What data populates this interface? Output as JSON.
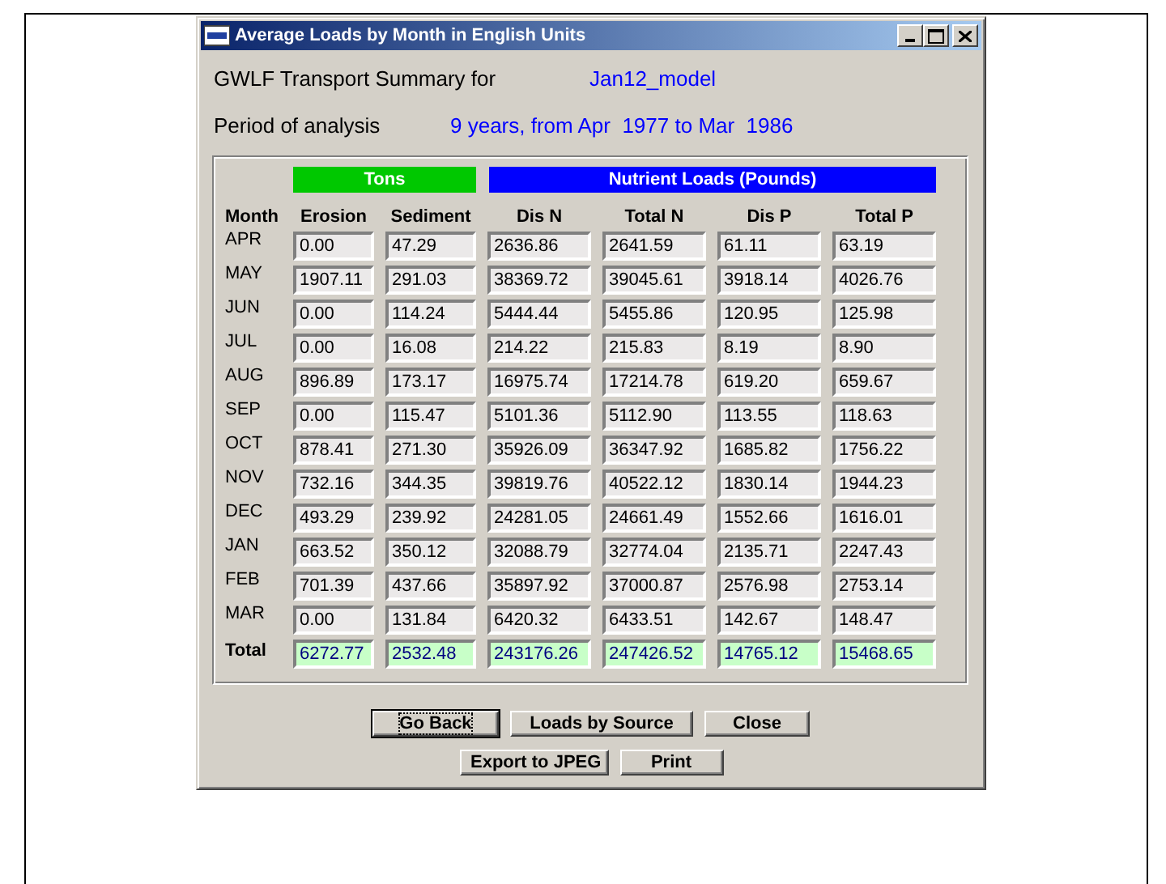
{
  "window": {
    "title": "Average Loads by Month in English Units"
  },
  "summary": {
    "label": "GWLF Transport Summary for",
    "value": "Jan12_model"
  },
  "period": {
    "label": "Period of analysis",
    "value": "9 years, from Apr  1977 to Mar  1986"
  },
  "groups": [
    {
      "label": "Tons",
      "color": "#00c800"
    },
    {
      "label": "Nutrient Loads (Pounds)",
      "color": "#0000ff"
    }
  ],
  "columns": [
    "Month",
    "Erosion",
    "Sediment",
    "Dis N",
    "Total N",
    "Dis P",
    "Total P"
  ],
  "rows": [
    {
      "kind": "month",
      "month": "APR",
      "values": [
        "0.00",
        "47.29",
        "2636.86",
        "2641.59",
        "61.11",
        "63.19"
      ]
    },
    {
      "kind": "month",
      "month": "MAY",
      "values": [
        "1907.11",
        "291.03",
        "38369.72",
        "39045.61",
        "3918.14",
        "4026.76"
      ]
    },
    {
      "kind": "month",
      "month": "JUN",
      "values": [
        "0.00",
        "114.24",
        "5444.44",
        "5455.86",
        "120.95",
        "125.98"
      ]
    },
    {
      "kind": "month",
      "month": "JUL",
      "values": [
        "0.00",
        "16.08",
        "214.22",
        "215.83",
        "8.19",
        "8.90"
      ]
    },
    {
      "kind": "month",
      "month": "AUG",
      "values": [
        "896.89",
        "173.17",
        "16975.74",
        "17214.78",
        "619.20",
        "659.67"
      ]
    },
    {
      "kind": "month",
      "month": "SEP",
      "values": [
        "0.00",
        "115.47",
        "5101.36",
        "5112.90",
        "113.55",
        "118.63"
      ]
    },
    {
      "kind": "month",
      "month": "OCT",
      "values": [
        "878.41",
        "271.30",
        "35926.09",
        "36347.92",
        "1685.82",
        "1756.22"
      ]
    },
    {
      "kind": "month",
      "month": "NOV",
      "values": [
        "732.16",
        "344.35",
        "39819.76",
        "40522.12",
        "1830.14",
        "1944.23"
      ]
    },
    {
      "kind": "month",
      "month": "DEC",
      "values": [
        "493.29",
        "239.92",
        "24281.05",
        "24661.49",
        "1552.66",
        "1616.01"
      ]
    },
    {
      "kind": "month",
      "month": "JAN",
      "values": [
        "663.52",
        "350.12",
        "32088.79",
        "32774.04",
        "2135.71",
        "2247.43"
      ]
    },
    {
      "kind": "month",
      "month": "FEB",
      "values": [
        "701.39",
        "437.66",
        "35897.92",
        "37000.87",
        "2576.98",
        "2753.14"
      ]
    },
    {
      "kind": "month",
      "month": "MAR",
      "values": [
        "0.00",
        "131.84",
        "6420.32",
        "6433.51",
        "142.67",
        "148.47"
      ]
    },
    {
      "kind": "total",
      "month": "Total",
      "values": [
        "6272.77",
        "2532.48",
        "243176.26",
        "247426.52",
        "14765.12",
        "15468.65"
      ]
    }
  ],
  "button_rows": [
    [
      {
        "label": "Go Back",
        "focused": true
      },
      {
        "label": "Loads by Source",
        "focused": false
      },
      {
        "label": "Close",
        "focused": false
      }
    ],
    [
      {
        "label": "Export to JPEG",
        "focused": false
      },
      {
        "label": "Print",
        "focused": false
      }
    ]
  ]
}
